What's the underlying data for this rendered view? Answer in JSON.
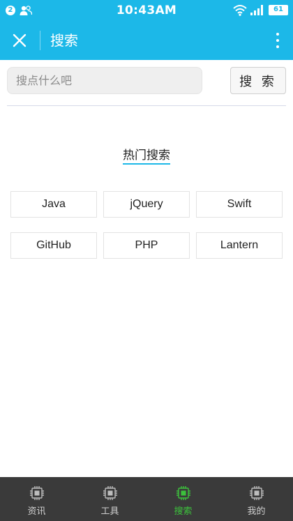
{
  "status_bar": {
    "notification_count": "2",
    "time": "10:43AM",
    "battery": "61"
  },
  "toolbar": {
    "close_icon": "close-icon",
    "title": "搜索",
    "more_icon": "more-vertical-icon"
  },
  "search": {
    "placeholder": "搜点什么吧",
    "value": "",
    "button_label": "搜 索"
  },
  "hot_search": {
    "title": "热门搜索",
    "tags": [
      "Java",
      "jQuery",
      "Swift",
      "GitHub",
      "PHP",
      "Lantern"
    ]
  },
  "bottom_nav": {
    "items": [
      {
        "label": "资讯",
        "icon": "chip-icon"
      },
      {
        "label": "工具",
        "icon": "chip-icon"
      },
      {
        "label": "搜索",
        "icon": "chip-icon"
      },
      {
        "label": "我的",
        "icon": "chip-icon"
      }
    ],
    "active_index": 2
  },
  "colors": {
    "header": "#1cb8e8",
    "nav_background": "#3a3a3a",
    "nav_active": "#3cc13c"
  }
}
